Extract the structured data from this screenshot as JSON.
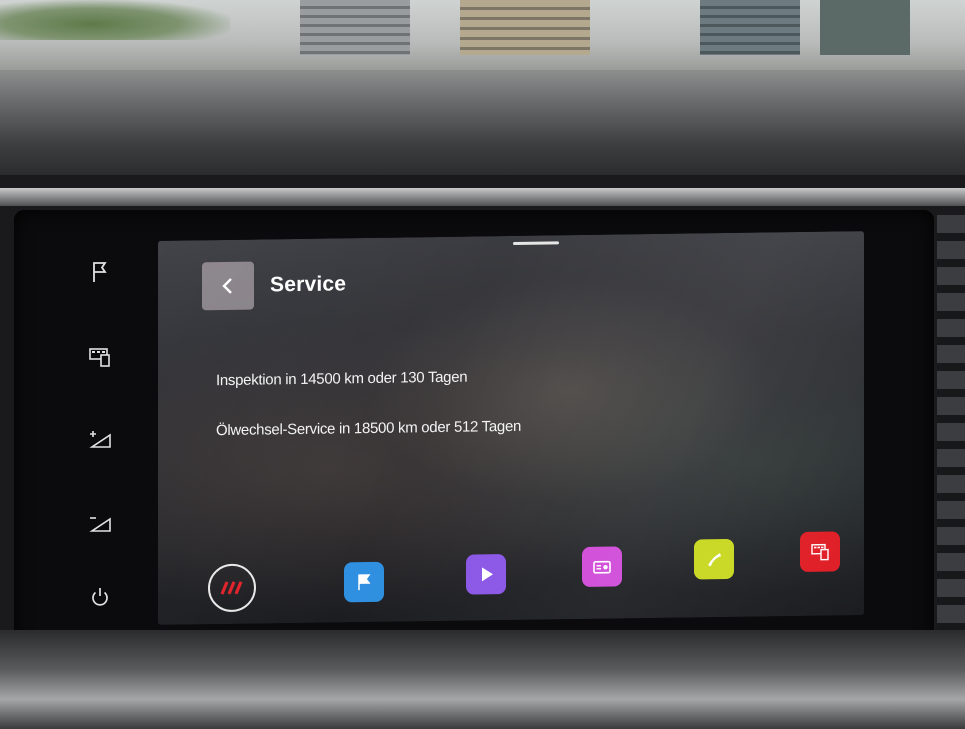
{
  "screen": {
    "title": "Service",
    "service_items": [
      "Inspektion in 14500 km oder 130 Tagen",
      "Ölwechsel-Service in 18500 km oder 512 Tagen"
    ]
  },
  "hardware_buttons": [
    {
      "icon": "navigation-flag-icon"
    },
    {
      "icon": "car-menu-icon"
    },
    {
      "icon": "volume-up-icon"
    },
    {
      "icon": "volume-down-icon"
    },
    {
      "icon": "power-icon"
    }
  ],
  "dock": [
    {
      "icon": "home-stripes-icon",
      "color": "#e0222b"
    },
    {
      "icon": "navigation-flag-icon",
      "color": "#2f8fe0"
    },
    {
      "icon": "media-play-icon",
      "color": "#8a55e6"
    },
    {
      "icon": "radio-icon",
      "color": "#d04bd8"
    },
    {
      "icon": "phone-icon",
      "color": "#c8d820"
    },
    {
      "icon": "car-menu-icon",
      "color": "#e01e26"
    }
  ]
}
